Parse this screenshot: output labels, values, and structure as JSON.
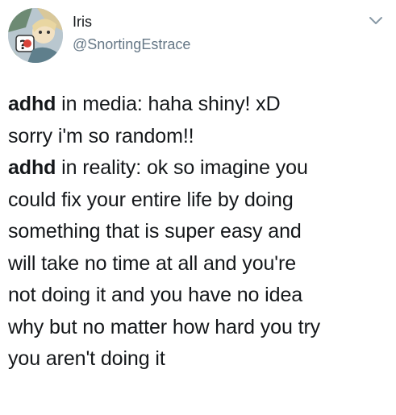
{
  "tweet": {
    "author": {
      "display_name": "Iris",
      "handle": "@SnortingEstrace",
      "avatar_icon": "cartoon-avatar"
    },
    "menu_icon": "chevron-down-icon",
    "colors": {
      "text": "#14171a",
      "secondary_text": "#657786",
      "chevron": "#8899a6",
      "background": "#ffffff"
    },
    "lines": [
      {
        "bold": "adhd",
        "text": " in media: haha shiny! xD"
      },
      {
        "bold": "",
        "text": "sorry i'm so random!!"
      },
      {
        "bold": "adhd",
        "text": " in reality: ok so imagine you"
      },
      {
        "bold": "",
        "text": "could fix your entire life by doing"
      },
      {
        "bold": "",
        "text": "something that is super easy and"
      },
      {
        "bold": "",
        "text": "will take no time at all and you're"
      },
      {
        "bold": "",
        "text": "not doing it and you have no idea"
      },
      {
        "bold": "",
        "text": "why but no matter how hard you try"
      },
      {
        "bold": "",
        "text": "you aren't doing it"
      }
    ]
  }
}
